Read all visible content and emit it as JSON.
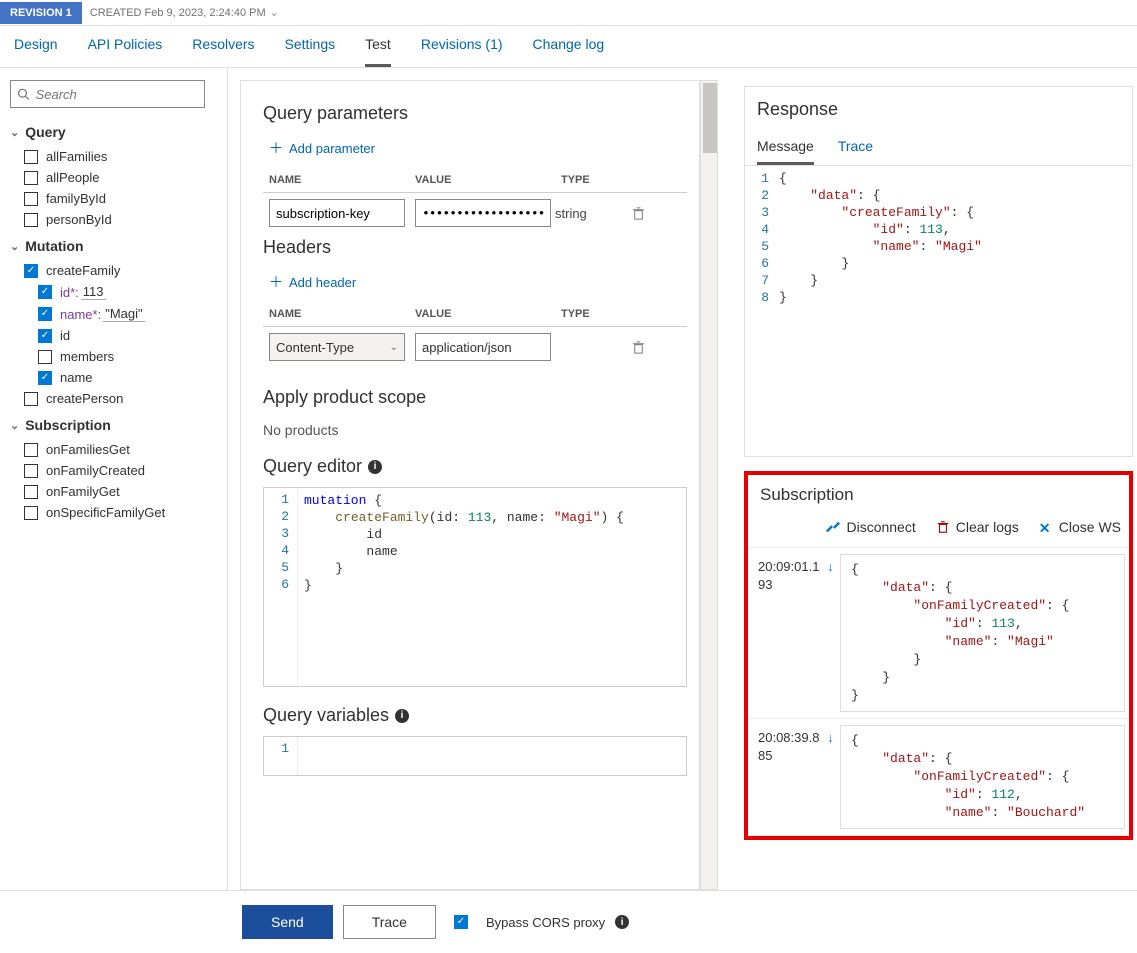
{
  "revision": {
    "badge": "REVISION 1",
    "created": "CREATED Feb 9, 2023, 2:24:40 PM"
  },
  "tabs": [
    "Design",
    "API Policies",
    "Resolvers",
    "Settings",
    "Test",
    "Revisions (1)",
    "Change log"
  ],
  "active_tab": "Test",
  "search_placeholder": "Search",
  "sidebar": {
    "query": {
      "title": "Query",
      "items": [
        "allFamilies",
        "allPeople",
        "familyById",
        "personById"
      ]
    },
    "mutation": {
      "title": "Mutation",
      "createFamily": {
        "label": "createFamily",
        "params": [
          {
            "label": "id*:",
            "value": "113",
            "checked": true
          },
          {
            "label": "name*:",
            "value": "\"Magi\"",
            "checked": true
          }
        ],
        "fields": [
          {
            "label": "id",
            "checked": true
          },
          {
            "label": "members",
            "checked": false
          },
          {
            "label": "name",
            "checked": true
          }
        ]
      },
      "createPerson": "createPerson"
    },
    "subscription": {
      "title": "Subscription",
      "items": [
        "onFamiliesGet",
        "onFamilyCreated",
        "onFamilyGet",
        "onSpecificFamilyGet"
      ]
    }
  },
  "center": {
    "qp_title": "Query parameters",
    "add_param": "Add parameter",
    "cols": {
      "name": "NAME",
      "value": "VALUE",
      "type": "TYPE"
    },
    "qp_row": {
      "name": "subscription-key",
      "value": "••••••••••••••••••••••••",
      "type": "string"
    },
    "headers_title": "Headers",
    "add_header": "Add header",
    "hdr_row": {
      "name": "Content-Type",
      "value": "application/json"
    },
    "scope_title": "Apply product scope",
    "no_products": "No products",
    "qe_title": "Query editor",
    "qe_code": {
      "l1": "mutation {",
      "l2": "    createFamily(id: 113, name: \"Magi\") {",
      "l3": "        id",
      "l4": "        name",
      "l5": "    }",
      "l6": "}"
    },
    "qv_title": "Query variables"
  },
  "response": {
    "title": "Response",
    "tabs": {
      "message": "Message",
      "trace": "Trace"
    },
    "json_lines": [
      "{",
      "    \"data\": {",
      "        \"createFamily\": {",
      "            \"id\": 113,",
      "            \"name\": \"Magi\"",
      "        }",
      "    }",
      "}"
    ]
  },
  "subscription_panel": {
    "title": "Subscription",
    "actions": {
      "disconnect": "Disconnect",
      "clear": "Clear logs",
      "close": "Close WS"
    },
    "logs": [
      {
        "ts1": "20:09:01.1",
        "ts2": "93",
        "body": "{\n    \"data\": {\n        \"onFamilyCreated\": {\n            \"id\": 113,\n            \"name\": \"Magi\"\n        }\n    }\n}"
      },
      {
        "ts1": "20:08:39.8",
        "ts2": "85",
        "body": "{\n    \"data\": {\n        \"onFamilyCreated\": {\n            \"id\": 112,\n            \"name\": \"Bouchard\""
      }
    ]
  },
  "footer": {
    "send": "Send",
    "trace": "Trace",
    "bypass": "Bypass CORS proxy"
  }
}
